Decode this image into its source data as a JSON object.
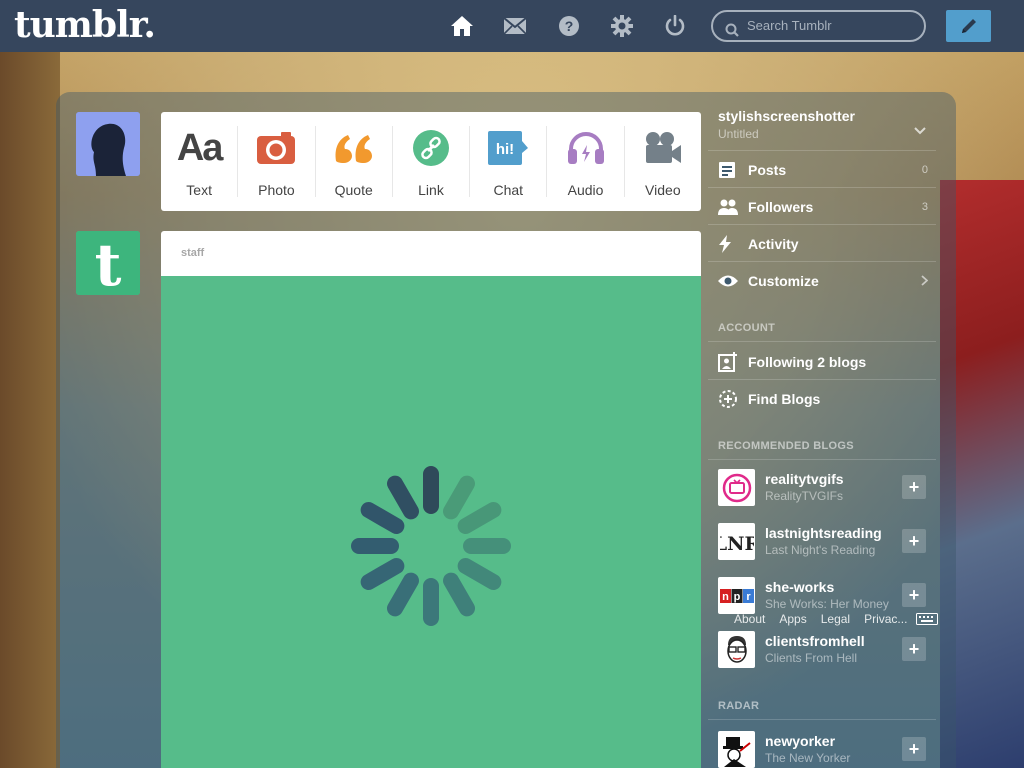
{
  "header": {
    "logo": "tumblr.",
    "search_placeholder": "Search Tumblr"
  },
  "post_types": [
    {
      "label": "Text",
      "color": "#444444"
    },
    {
      "label": "Photo",
      "color": "#d95e40"
    },
    {
      "label": "Quote",
      "color": "#f2992e"
    },
    {
      "label": "Link",
      "color": "#56bc8a"
    },
    {
      "label": "Chat",
      "color": "#529ecc"
    },
    {
      "label": "Audio",
      "color": "#a77dc2"
    },
    {
      "label": "Video",
      "color": "#748089"
    }
  ],
  "post": {
    "author": "staff",
    "loading_color": "#56bc8a"
  },
  "sidebar": {
    "blog_name": "stylishscreenshotter",
    "blog_title": "Untitled",
    "items": [
      {
        "label": "Posts",
        "count": "0"
      },
      {
        "label": "Followers",
        "count": "3"
      },
      {
        "label": "Activity",
        "count": ""
      },
      {
        "label": "Customize",
        "count": ""
      }
    ],
    "account_heading": "ACCOUNT",
    "account_items": [
      {
        "label": "Following 2 blogs"
      },
      {
        "label": "Find Blogs"
      }
    ],
    "recommended_heading": "RECOMMENDED BLOGS",
    "recommended": [
      {
        "name": "realitytvgifs",
        "subtitle": "RealityTVGIFs"
      },
      {
        "name": "lastnightsreading",
        "subtitle": "Last Night's Reading"
      },
      {
        "name": "she-works",
        "subtitle": "She Works: Her Money"
      },
      {
        "name": "clientsfromhell",
        "subtitle": "Clients From Hell"
      }
    ],
    "footer_links": [
      "About",
      "Apps",
      "Legal",
      "Privac..."
    ],
    "radar_heading": "RADAR",
    "radar": [
      {
        "name": "newyorker",
        "subtitle": "The New Yorker"
      }
    ]
  }
}
